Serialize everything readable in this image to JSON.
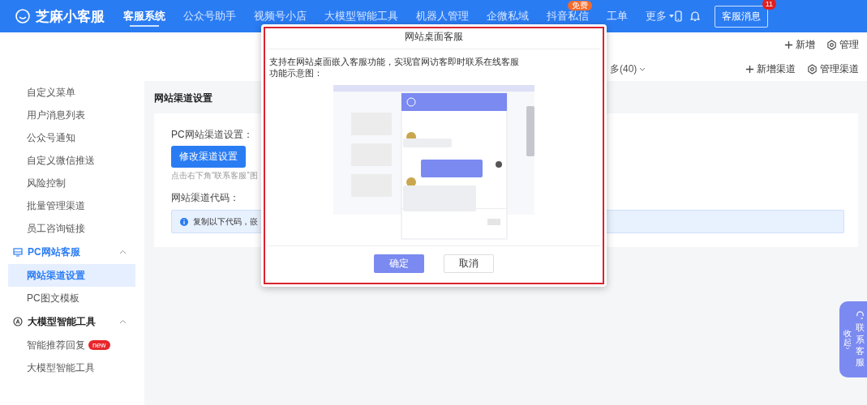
{
  "header": {
    "logo": "芝麻小客服",
    "nav": [
      {
        "label": "客服系统",
        "selected": true
      },
      {
        "label": "公众号助手",
        "selected": false
      },
      {
        "label": "视频号小店",
        "selected": false
      },
      {
        "label": "大模型智能工具",
        "selected": false
      },
      {
        "label": "机器人管理",
        "selected": false
      },
      {
        "label": "企微私域",
        "selected": false
      },
      {
        "label": "抖音私信",
        "selected": false,
        "badge": "免费"
      },
      {
        "label": "工单",
        "selected": false
      },
      {
        "label": "更多",
        "selected": false,
        "dropdown": true
      }
    ],
    "message_button": {
      "label": "客服消息",
      "badge": "11"
    }
  },
  "toolbar": {
    "actions": [
      {
        "label": "新增",
        "kind": "add"
      },
      {
        "label": "管理",
        "kind": "manage"
      }
    ]
  },
  "channel_bar": {
    "more": "多(40)",
    "actions": [
      {
        "label": "新增渠道",
        "kind": "add"
      },
      {
        "label": "管理渠道",
        "kind": "manage"
      }
    ]
  },
  "sidebar": {
    "items": [
      {
        "label": "自定义菜单",
        "kind": "item",
        "selected": false
      },
      {
        "label": "用户消息列表",
        "kind": "item",
        "selected": false
      },
      {
        "label": "公众号通知",
        "kind": "item",
        "selected": false
      },
      {
        "label": "自定义微信推送",
        "kind": "item",
        "selected": false
      },
      {
        "label": "风险控制",
        "kind": "item",
        "selected": false
      },
      {
        "label": "批量管理渠道",
        "kind": "item",
        "selected": false
      },
      {
        "label": "员工咨询链接",
        "kind": "item",
        "selected": false
      },
      {
        "label": "PC网站客服",
        "kind": "group",
        "expanded": true,
        "active": true,
        "children": [
          {
            "label": "网站渠道设置",
            "kind": "item",
            "selected": true
          },
          {
            "label": "PC图文模板",
            "kind": "item",
            "selected": false
          }
        ]
      },
      {
        "label": "大模型智能工具",
        "kind": "group",
        "expanded": true,
        "active": false,
        "children": [
          {
            "label": "智能推荐回复",
            "kind": "item",
            "selected": false,
            "badge": "new"
          },
          {
            "label": "大模型智能工具",
            "kind": "item",
            "selected": false
          }
        ]
      }
    ]
  },
  "page": {
    "title": "网站渠道设置",
    "pc_setting_label": "PC网站渠道设置：",
    "edit_button": "修改渠道设置",
    "hint": "点击右下角“联系客服”图",
    "code_label": "网站渠道代码：",
    "alert": "复制以下代码，嵌"
  },
  "dialog": {
    "title": "网站桌面客服",
    "description": "支持在网站桌面嵌入客服功能，实现官网访客即时联系在线客服",
    "caption": "功能示意图：",
    "buttons": [
      {
        "label": "确定",
        "kind": "primary"
      },
      {
        "label": "取消",
        "kind": "default"
      }
    ]
  },
  "float_widget": {
    "label": "联系客服",
    "collapse": "收起"
  }
}
